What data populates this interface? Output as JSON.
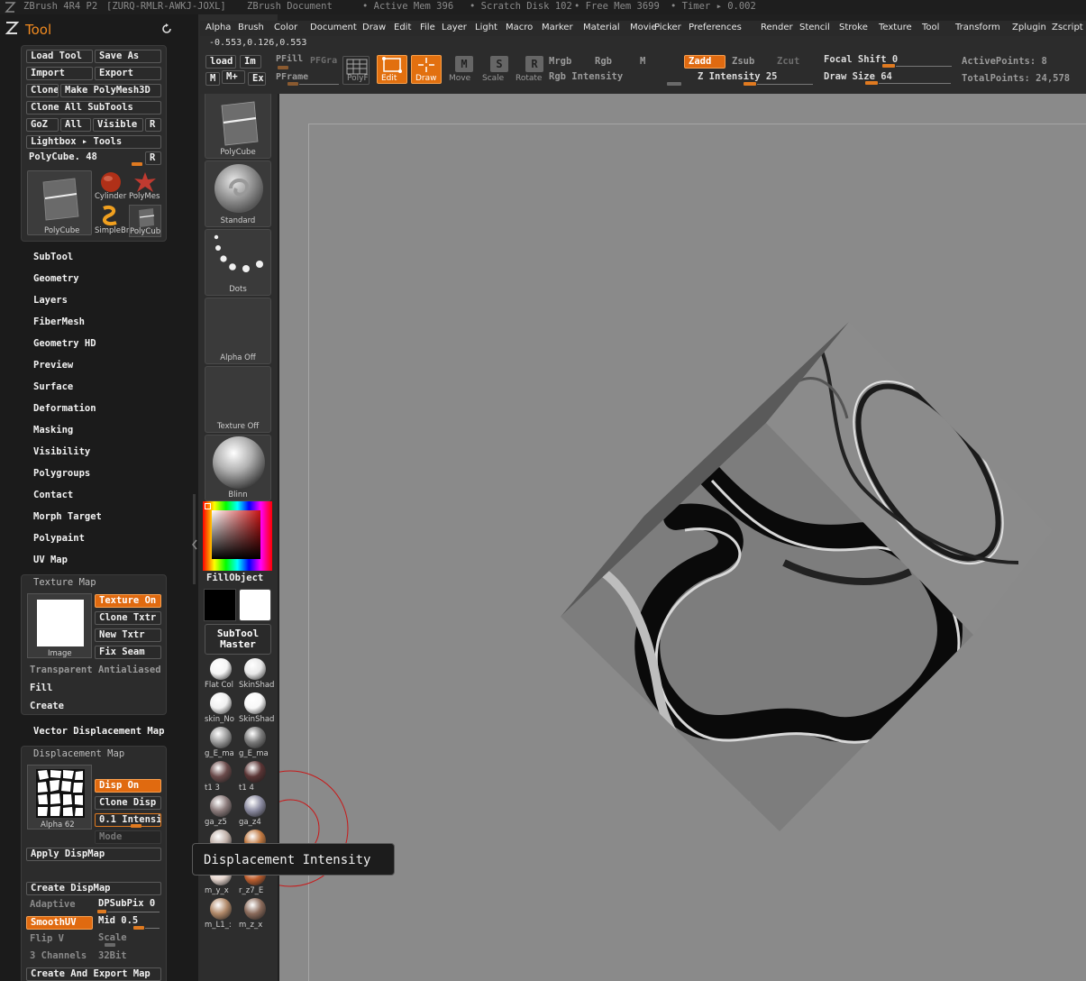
{
  "titlebar": {
    "app": "ZBrush 4R4 P2",
    "serial": "[ZURQ-RMLR-AWKJ-JOXL]",
    "document": "ZBrush Document",
    "active_mem": "• Active Mem 396",
    "scratch_disk": "• Scratch Disk 102",
    "free_mem": "• Free Mem 3699",
    "timer": "• Timer ▸ 0.002"
  },
  "menus": [
    "Alpha",
    "Brush",
    "Color",
    "Document",
    "Draw",
    "Edit",
    "File",
    "Layer",
    "Light",
    "Macro",
    "Marker",
    "Material",
    "Movie",
    "Picker",
    "Preferences",
    "Render",
    "Stencil",
    "Stroke",
    "Texture",
    "Tool",
    "Transform",
    "Zplugin",
    "Zscript"
  ],
  "shelf": {
    "coords": "-0.553,0.126,0.553",
    "load": "load",
    "im": "Im",
    "m": "M",
    "m_plus": "M+",
    "ex": "Ex",
    "pfill": "PFill",
    "pfgra": "PFGra",
    "pframe": "PFrame",
    "polyf": "PolyF",
    "edit": "Edit",
    "draw": "Draw",
    "move": "Move",
    "scale": "Scale",
    "rotate": "Rotate",
    "mrgb": "Mrgb",
    "rgb": "Rgb",
    "m2": "M",
    "rgb_intensity": "Rgb Intensity",
    "zadd": "Zadd",
    "zsub": "Zsub",
    "zcut": "Zcut",
    "z_intensity": "Z Intensity 25",
    "focal_shift": "Focal Shift 0",
    "draw_size": "Draw Size 64",
    "active_points": "ActivePoints: 8",
    "total_points": "TotalPoints: 24,578"
  },
  "tool_panel": {
    "title": "Tool",
    "load_tool": "Load Tool",
    "save_as": "Save As",
    "import": "Import",
    "export": "Export",
    "clone": "Clone",
    "make_polymesh": "Make PolyMesh3D",
    "clone_all": "Clone All SubTools",
    "goz": "GoZ",
    "all": "All",
    "visible": "Visible",
    "r": "R",
    "lightbox": "Lightbox ▸ Tools",
    "polycube_slider": "PolyCube. 48",
    "r2": "R",
    "thumb_main": "PolyCube",
    "thumb_cylinder": "Cylinder",
    "thumb_polymesh": "PolyMes",
    "thumb_simplebrush": "SimpleBr",
    "thumb_polycube2": "PolyCub",
    "items": [
      "SubTool",
      "Geometry",
      "Layers",
      "FiberMesh",
      "Geometry HD",
      "Preview",
      "Surface",
      "Deformation",
      "Masking",
      "Visibility",
      "Polygroups",
      "Contact",
      "Morph Target",
      "Polypaint",
      "UV Map"
    ],
    "texture_map": {
      "title": "Texture Map",
      "image_label": "Image",
      "texture_on": "Texture On",
      "clone_txtr": "Clone Txtr",
      "new_txtr": "New Txtr",
      "fix_seam": "Fix Seam",
      "transparent": "Transparent",
      "antialiased": "Antialiased",
      "fill": "Fill",
      "create": "Create"
    },
    "vector_displacement": "Vector Displacement Map",
    "displacement_map": {
      "title": "Displacement Map",
      "alpha_label": "Alpha 62",
      "disp_on": "Disp On",
      "clone_disp": "Clone Disp",
      "intensity": "0.1 Intensity",
      "mode": "Mode",
      "apply": "Apply DispMap",
      "create_dispmap": "Create DispMap",
      "adaptive": "Adaptive",
      "dpsubpix": "DPSubPix 0",
      "smoothuv": "SmoothUV",
      "mid": "Mid 0.5",
      "flipv": "Flip V",
      "scale": "Scale",
      "channels": "3 Channels",
      "bit32": "32Bit",
      "create_export": "Create And Export Map"
    }
  },
  "mid_column": {
    "slot_tool": "PolyCube",
    "slot_brush": "Standard",
    "slot_stroke": "Dots",
    "slot_alpha": "Alpha  Off",
    "slot_texture": "Texture  Off",
    "slot_material": "Blinn",
    "fill_object": "FillObject",
    "subtool_master": "SubTool Master",
    "materials": [
      {
        "label": "Flat  Col",
        "color": "#f5f5f5"
      },
      {
        "label": "SkinShad",
        "color": "#e8e8e8"
      },
      {
        "label": "skin_No",
        "color": "#f0f0f0"
      },
      {
        "label": "SkinShad",
        "color": "#f8f8f8"
      },
      {
        "label": "g_E_ma",
        "color": "#9a9a9a"
      },
      {
        "label": "g_E_ma",
        "color": "#7a7a7a"
      },
      {
        "label": "t1 3",
        "color": "#6a4a4a"
      },
      {
        "label": "t1 4",
        "color": "#5a3434"
      },
      {
        "label": "ga_z5",
        "color": "#8a7a7a"
      },
      {
        "label": "ga_z4",
        "color": "#8a8aa0"
      },
      {
        "label": "MatCap",
        "color": "#c0b0a8"
      },
      {
        "label": "r_z7_E",
        "color": "#c07840"
      },
      {
        "label": "m_y_x",
        "color": "#e8d8d0"
      },
      {
        "label": "r_z7_E",
        "color": "#c06030"
      },
      {
        "label": "m_L1_:",
        "color": "#b08868"
      },
      {
        "label": "m_z_x",
        "color": "#8a6a5a"
      }
    ]
  },
  "tooltip": "Displacement Intensity"
}
